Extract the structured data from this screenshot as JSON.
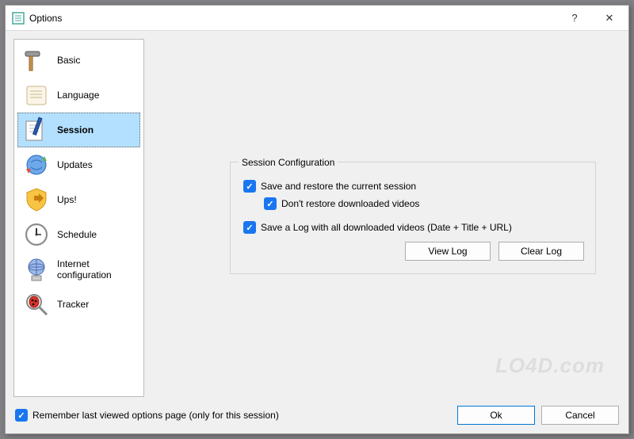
{
  "window": {
    "title": "Options",
    "help_symbol": "?",
    "close_symbol": "✕"
  },
  "sidebar": {
    "items": [
      {
        "label": "Basic"
      },
      {
        "label": "Language"
      },
      {
        "label": "Session"
      },
      {
        "label": "Updates"
      },
      {
        "label": "Ups!"
      },
      {
        "label": "Schedule"
      },
      {
        "label": "Internet configuration"
      },
      {
        "label": "Tracker"
      }
    ],
    "selected_index": 2
  },
  "session_panel": {
    "group_title": "Session Configuration",
    "save_restore_label": "Save and restore the current session",
    "save_restore_checked": true,
    "dont_restore_label": "Don't restore downloaded videos",
    "dont_restore_checked": true,
    "save_log_label": "Save a Log with all downloaded videos (Date + Title + URL)",
    "save_log_checked": true,
    "view_log_btn": "View Log",
    "clear_log_btn": "Clear Log"
  },
  "footer": {
    "remember_label": "Remember last viewed options page (only for this session)",
    "remember_checked": true,
    "ok_label": "Ok",
    "cancel_label": "Cancel"
  },
  "watermark": "LO4D.com"
}
